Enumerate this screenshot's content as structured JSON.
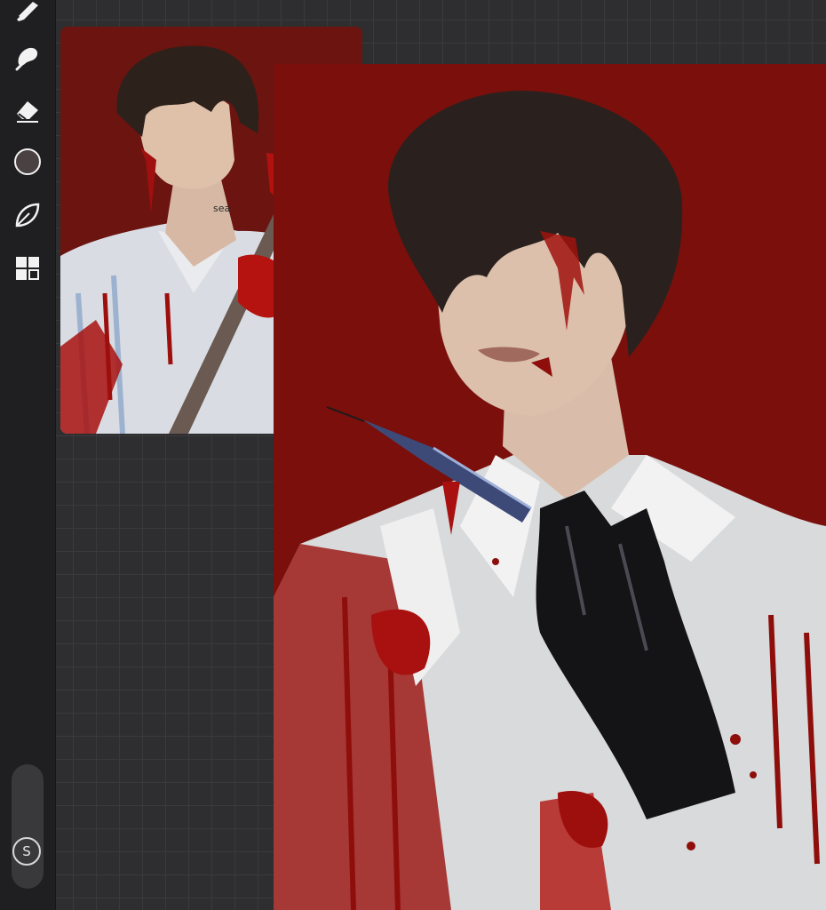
{
  "toolbar": {
    "tools": [
      {
        "name": "brush-icon"
      },
      {
        "name": "smudge-icon"
      },
      {
        "name": "eraser-icon"
      },
      {
        "name": "color-swatch-icon",
        "color": "#4a4143"
      },
      {
        "name": "leaf-shape-icon"
      },
      {
        "name": "layers-grid-icon"
      }
    ],
    "size_slider_label": "S"
  },
  "reference_image": {
    "tattoo_text": "sea"
  },
  "colors": {
    "background_red": "#7a0f0b",
    "blood": "#a8110f",
    "toolbar": "#1f1f21",
    "grid": "#2e2e30"
  }
}
